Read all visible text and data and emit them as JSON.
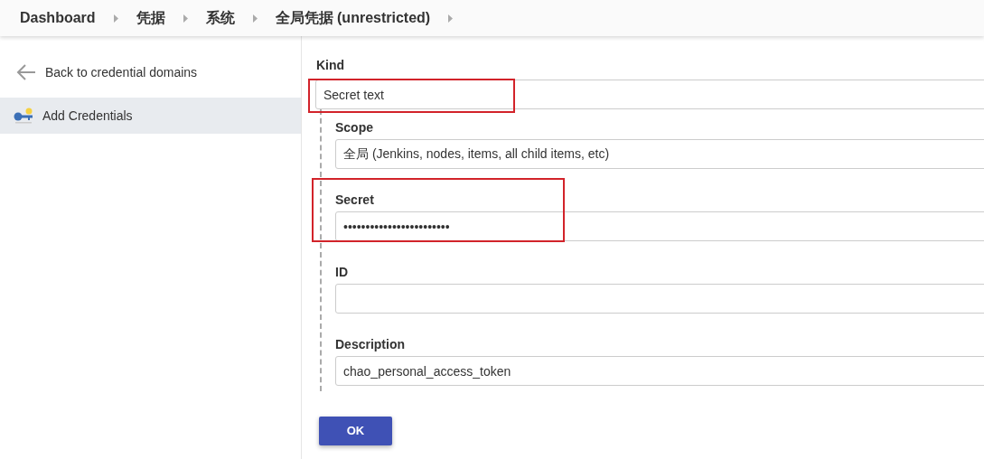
{
  "breadcrumbs": [
    "Dashboard",
    "凭据",
    "系统",
    "全局凭据 (unrestricted)"
  ],
  "sidebar": {
    "items": [
      {
        "kind": "back",
        "label": "Back to credential domains",
        "selected": false
      },
      {
        "kind": "key",
        "label": "Add Credentials",
        "selected": true
      }
    ]
  },
  "form": {
    "kind": {
      "label": "Kind",
      "value": "Secret text",
      "highlighted": true
    },
    "fields": [
      {
        "label": "Scope",
        "value": "全局 (Jenkins, nodes, items, all child items, etc)",
        "highlighted": false
      },
      {
        "label": "Secret",
        "value": "••••••••••••••••••••••••",
        "highlighted": true
      },
      {
        "label": "ID",
        "highlighted": false
      },
      {
        "label": "Description",
        "value": "chao_personal_access_token",
        "highlighted": false
      }
    ],
    "submit": "OK"
  }
}
